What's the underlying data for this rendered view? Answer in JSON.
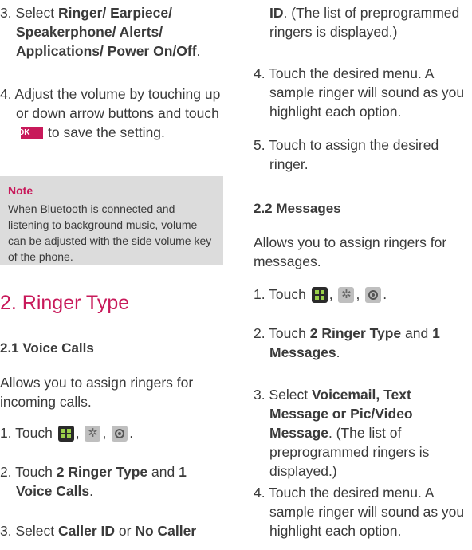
{
  "left": {
    "step3": {
      "num": "3.",
      "pre": "Select",
      "bold": "Ringer/ Earpiece/ Speakerphone/ Alerts/ Applications/ Power On/Off",
      "post": "."
    },
    "step4": {
      "num": "4.",
      "text_a": "Adjust the volume by touching up or down arrow buttons and touch",
      "ok_label": "OK",
      "text_b": "to save the setting."
    },
    "note": {
      "title": "Note",
      "body": "When Bluetooth is connected and listening to background music, volume can be adjusted with the side volume key of the phone."
    },
    "section_title": "2. Ringer Type",
    "voice_calls": {
      "heading": "2.1 Voice Calls",
      "intro": "Allows you to assign ringers for incoming calls.",
      "step1": {
        "num": "1.",
        "text": "Touch",
        "icons": [
          "menu-icon",
          "settings-gear-icon",
          "sound-disc-icon"
        ]
      },
      "step2": {
        "num": "2.",
        "pre": "Touch",
        "bold_a": "2 Ringer Type",
        "mid": "and",
        "bold_b": "1 Voice Calls",
        "post": "."
      },
      "step3": {
        "num": "3.",
        "pre": "Select",
        "bold_a": "Caller ID",
        "mid": "or",
        "bold_b": "No Caller"
      }
    }
  },
  "right": {
    "cont": {
      "bold": "ID",
      "text": ". (The list of preprogrammed ringers is displayed.)"
    },
    "step4": {
      "num": "4.",
      "text": "Touch the desired menu. A sample ringer will sound as you highlight each option."
    },
    "step5": {
      "num": "5.",
      "text": "Touch to assign the desired ringer."
    },
    "messages": {
      "heading": "2.2 Messages",
      "intro": "Allows you to assign ringers for messages.",
      "step1": {
        "num": "1.",
        "text": "Touch"
      },
      "step2": {
        "num": "2.",
        "pre": "Touch",
        "bold_a": "2 Ringer Type",
        "mid": "and",
        "bold_b": "1 Messages",
        "post": "."
      },
      "step3": {
        "num": "3.",
        "pre": "Select",
        "bold": "Voicemail, Text Message or Pic/Video Message",
        "post": ". (The list of preprogrammed ringers is displayed.)"
      },
      "step4": {
        "num": "4.",
        "text": "Touch the desired menu. A sample ringer will sound as you highlight each option."
      }
    }
  }
}
